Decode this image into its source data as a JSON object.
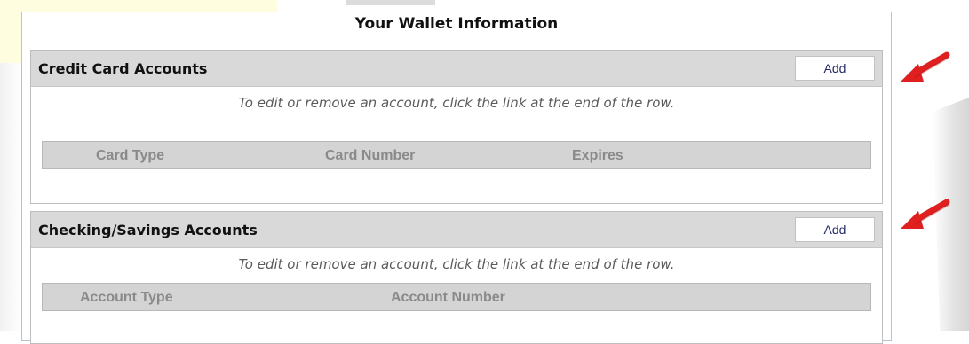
{
  "wallet": {
    "title": "Your Wallet Information",
    "hint_text": "To edit or remove an account, click the link at the end of the row.",
    "credit_cards": {
      "title": "Credit Card Accounts",
      "add_label": "Add",
      "columns": [
        "Card Type",
        "Card Number",
        "Expires"
      ]
    },
    "bank_accounts": {
      "title": "Checking/Savings Accounts",
      "add_label": "Add",
      "columns": [
        "Account Type",
        "Account Number"
      ]
    }
  },
  "colors": {
    "annotation_arrow": "#e02020",
    "header_bg": "#d9d9d9",
    "button_text": "#222a6b"
  },
  "icons": {
    "annotation": "red-arrow-icon"
  }
}
